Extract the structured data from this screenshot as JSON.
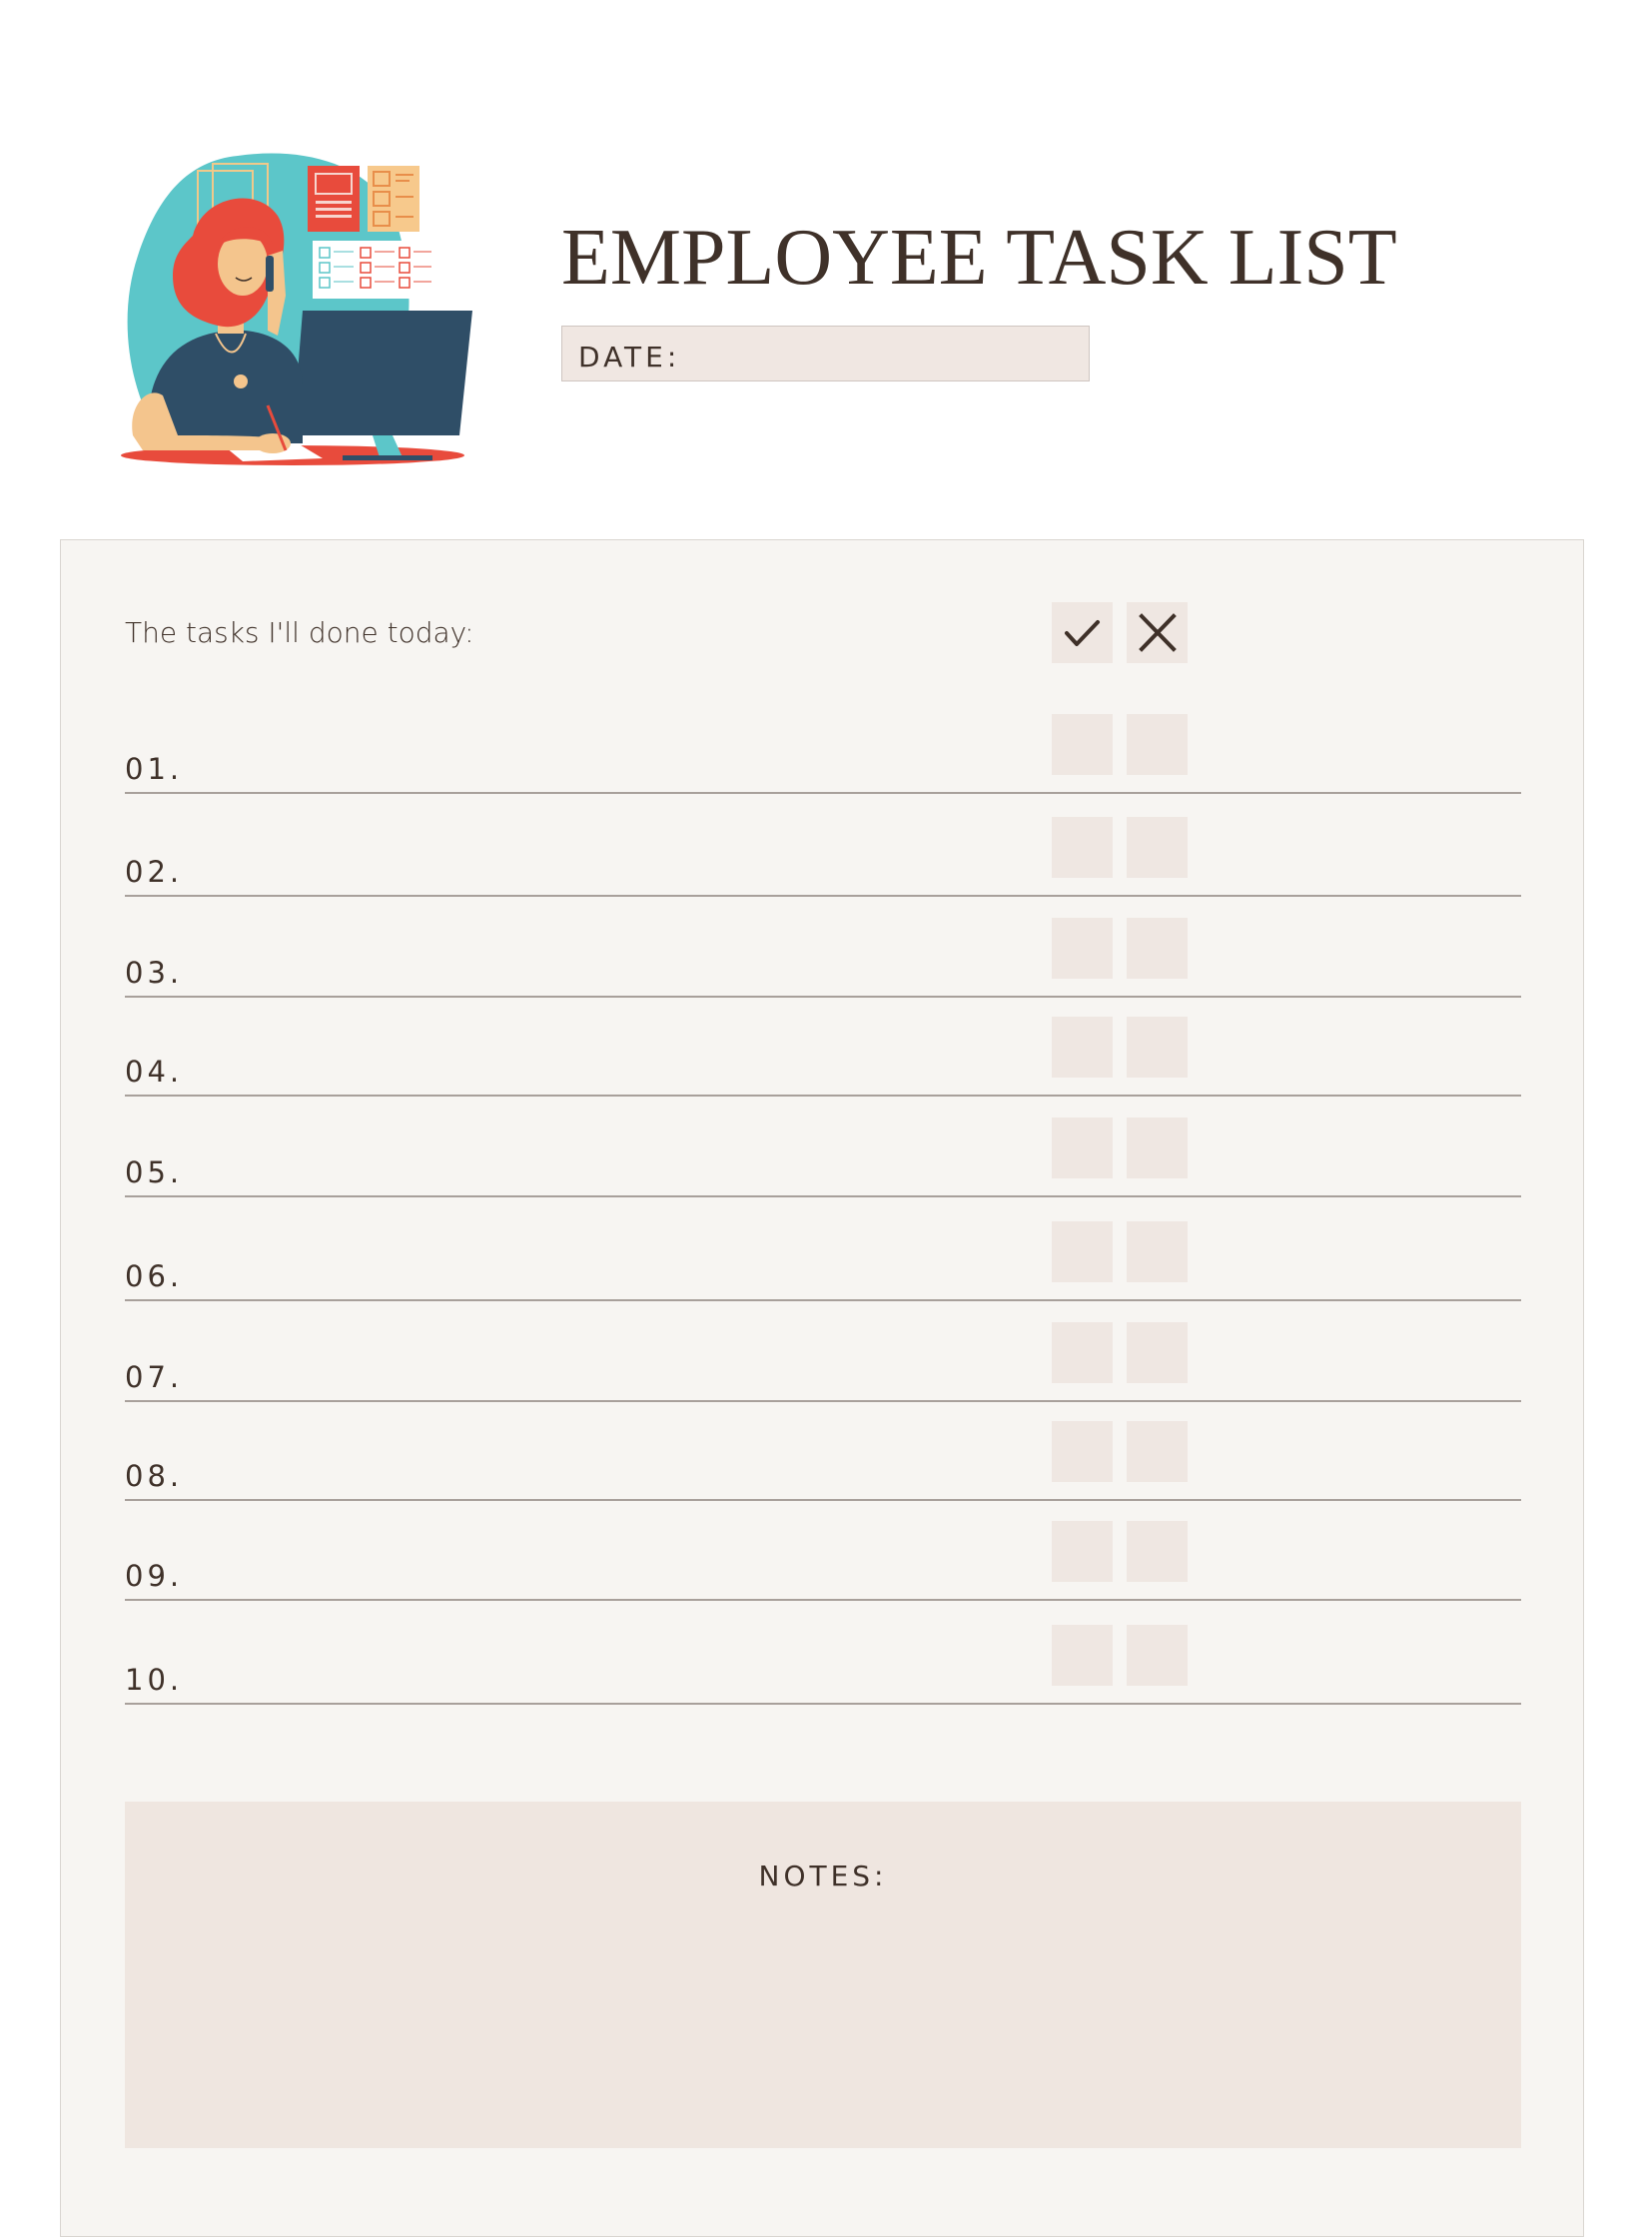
{
  "document": {
    "title": "EMPLOYEE TASK LIST",
    "date_label": "DATE:",
    "intro": "The tasks I'll done today:",
    "header_icons": [
      "check-icon",
      "x-icon"
    ],
    "rows": [
      {
        "number": "01."
      },
      {
        "number": "02."
      },
      {
        "number": "03."
      },
      {
        "number": "04."
      },
      {
        "number": "05."
      },
      {
        "number": "06."
      },
      {
        "number": "07."
      },
      {
        "number": "08."
      },
      {
        "number": "09."
      },
      {
        "number": "10."
      }
    ],
    "notes_label": "NOTES:"
  },
  "colors": {
    "text": "#3f3129",
    "panel": "#f7f5f2",
    "box": "#efe7e2",
    "line": "#a8a09b",
    "accent_red": "#e84b3c",
    "accent_teal": "#5cc6c9",
    "accent_navy": "#2f4e67"
  }
}
